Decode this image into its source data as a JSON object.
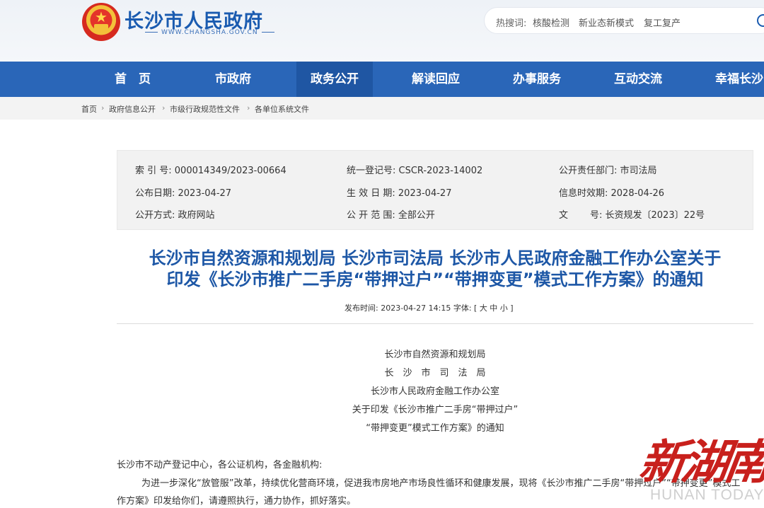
{
  "header": {
    "site_title": "长沙市人民政府",
    "site_url": "WWW.CHANGSHA.GOV.CN",
    "hot_label": "热搜词:",
    "hot_words": [
      "核酸检测",
      "新业态新模式",
      "复工复产"
    ]
  },
  "nav": [
    "首　页",
    "市政府",
    "政务公开",
    "解读回应",
    "办事服务",
    "互动交流",
    "幸福长沙"
  ],
  "breadcrumb": [
    "首页",
    "政府信息公开",
    "市级行政规范性文件",
    "各单位系统文件"
  ],
  "breadcrumb_sep": "›",
  "info": {
    "index_no": "索 引 号:  000014349/2023-00664",
    "unified_no": "统一登记号:  CSCR-2023-14002",
    "dept": "公开责任部门:  市司法局",
    "publish_date": "公布日期:  2023-04-27",
    "effective_date": "生 效 日 期:  2023-04-27",
    "expire_date": "信息时效期:  2028-04-26",
    "method": "公开方式:  政府网站",
    "scope": "公 开 范 围:  全部公开",
    "doc_no_label": "文",
    "doc_no": "号:  长资规发〔2023〕22号"
  },
  "article": {
    "title_line1": "长沙市自然资源和规划局 长沙市司法局 长沙市人民政府金融工作办公室关于",
    "title_line2": "印发《长沙市推广二手房“带押过户”“带押变更”模式工作方案》的通知",
    "meta": "发布时间: 2023-04-27 14:15   字体: [ 大 中 小 ]",
    "header_lines": [
      "长沙市自然资源和规划局",
      "长　沙　市　司　法　局",
      "长沙市人民政府金融工作办公室",
      "关于印发《长沙市推广二手房“带押过户”",
      "“带押变更”模式工作方案》的通知"
    ],
    "salutation": "长沙市不动产登记中心，各公证机构，各金融机构:",
    "para1": "为进一步深化“放管服”改革，持续优化营商环境，促进我市房地产市场良性循环和健康发展，现将《长沙市推广二手房“带押过户”“带押变更”模式工",
    "para1_cont": "作方案》印发给你们，请遵照执行，通力协作，抓好落实。"
  },
  "watermark": {
    "cn": "新湖南",
    "en": "HUNAN TODAY"
  }
}
